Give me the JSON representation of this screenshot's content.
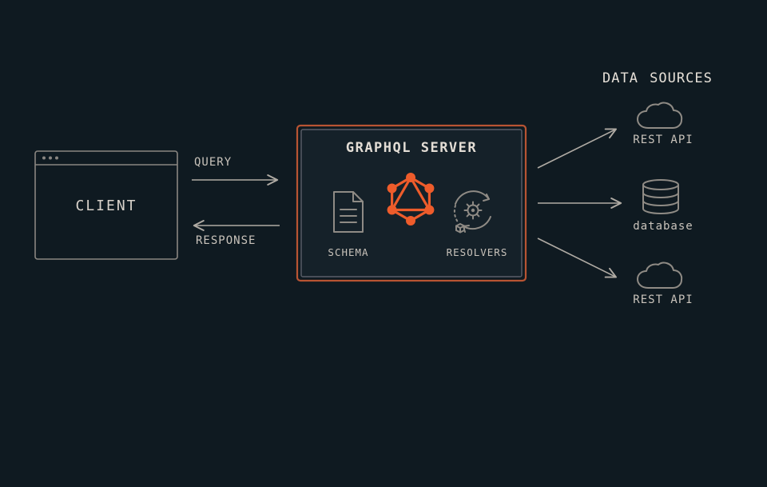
{
  "title": "DATA SOURCES",
  "client": {
    "label": "CLIENT"
  },
  "arrows": {
    "query": "QUERY",
    "response": "RESPONSE"
  },
  "server": {
    "title": "GRAPHQL SERVER",
    "schema_label": "SCHEMA",
    "resolvers_label": "RESOLVERS"
  },
  "sources": {
    "rest_api_top": "REST API",
    "database": "database",
    "rest_api_bottom": "REST API"
  },
  "colors": {
    "bg": "#0f1a21",
    "line": "#8a8681",
    "text": "#d4cec6",
    "accent": "#ee5c2b",
    "panel_fill": "#152129",
    "panel_inner": "#5b5f6a"
  }
}
